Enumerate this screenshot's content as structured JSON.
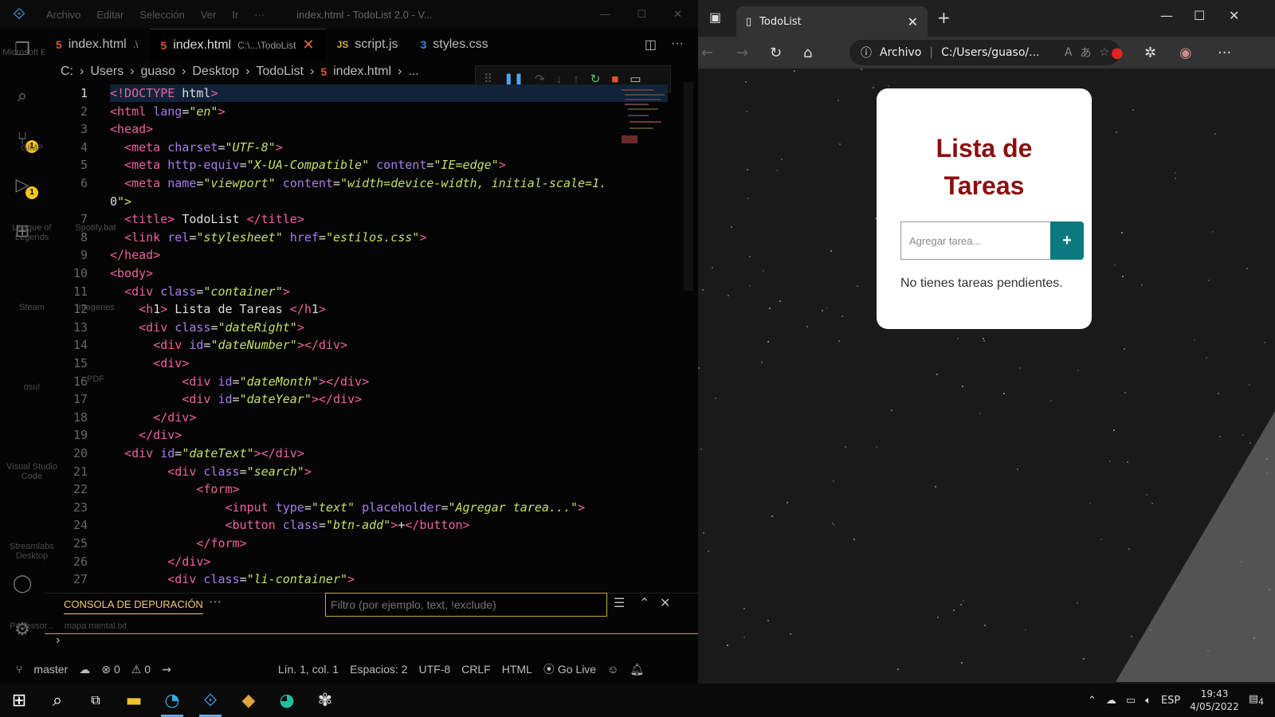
{
  "vscode": {
    "title": "index.html - TodoList 2.0 - V...",
    "menu": [
      "Archivo",
      "Editar",
      "Selección",
      "Ver",
      "Ir",
      "···"
    ],
    "tabs": [
      {
        "label": "index.html",
        "hint": ".\\",
        "active": false,
        "icon": "html5-icon"
      },
      {
        "label": "index.html",
        "hint": "C:\\...\\TodoList",
        "active": true,
        "icon": "html5-icon"
      },
      {
        "label": "script.js",
        "hint": "",
        "active": false,
        "icon": "js-icon"
      },
      {
        "label": "styles.css",
        "hint": "",
        "active": false,
        "icon": "css3-icon"
      }
    ],
    "breadcrumb": [
      "C:",
      "Users",
      "guaso",
      "Desktop",
      "TodoList",
      "index.html",
      "..."
    ],
    "desktop_labels": [
      "Microsoft Edge",
      "GIMP",
      "League of Legends",
      "Steam",
      "osu!",
      "Visual Studio Code",
      "Streamlabs Desktop",
      "Perfessor...",
      "Spotify.bat",
      "imagenes",
      "PDF",
      "mapa mental.txt"
    ],
    "activity_badges": {
      "source_control": "1",
      "run_debug": "1"
    },
    "code": {
      "line_numbers": [
        "1",
        "2",
        "3",
        "4",
        "5",
        "6",
        "",
        "7",
        "8",
        "9",
        "10",
        "11",
        "12",
        "13",
        "14",
        "15",
        "16",
        "17",
        "18",
        "19",
        "20",
        "21",
        "22",
        "23",
        "24",
        "25",
        "26",
        "27"
      ],
      "lines": [
        "<!DOCTYPE html>",
        "<html lang=\"en\">",
        "<head>",
        "  <meta charset=\"UTF-8\">",
        "  <meta http-equiv=\"X-UA-Compatible\" content=\"IE=edge\">",
        "  <meta name=\"viewport\" content=\"width=device-width, initial-scale=1.",
        "0\">",
        "  <title> TodoList </title>",
        "  <link rel=\"stylesheet\" href=\"estilos.css\">",
        "</head>",
        "<body>",
        "  <div class=\"container\">",
        "    <h1> Lista de Tareas </h1>",
        "    <div class=\"dateRight\">",
        "      <div id=\"dateNumber\"></div>",
        "      <div>",
        "          <div id=\"dateMonth\"></div>",
        "          <div id=\"dateYear\"></div>",
        "      </div>",
        "    </div>",
        "  <div id=\"dateText\"></div>",
        "        <div class=\"search\">",
        "            <form>",
        "                <input type=\"text\" placeholder=\"Agregar tarea...\">",
        "                <button class=\"btn-add\">+</button>",
        "            </form>",
        "        </div>",
        "        <div class=\"li-container\">"
      ]
    },
    "panel": {
      "tab": "CONSOLA DE DEPURACIÓN",
      "filter_placeholder": "Filtro (por ejemplo, text, !exclude)"
    },
    "status": {
      "branch": "master",
      "errors": "0",
      "warnings": "0",
      "position": "Lín. 1, col. 1",
      "spaces": "Espacios: 2",
      "encoding": "UTF-8",
      "eol": "CRLF",
      "language": "HTML",
      "golive": "Go Live"
    }
  },
  "browser": {
    "tab_title": "TodoList",
    "address_label": "Archivo",
    "address": "C:/Users/guaso/...",
    "page": {
      "heading_line1": "Lista de",
      "heading_line2": "Tareas",
      "input_placeholder": "Agregar tarea...",
      "add_label": "+",
      "empty_message": "No tienes tareas pendientes."
    }
  },
  "taskbar": {
    "lang": "ESP",
    "time": "19:43",
    "date": "4/05/2022",
    "notifications": "4"
  },
  "colors": {
    "heading": "#8b0f0f",
    "add_button": "#0b7a80",
    "filter_border": "#c9a640"
  }
}
